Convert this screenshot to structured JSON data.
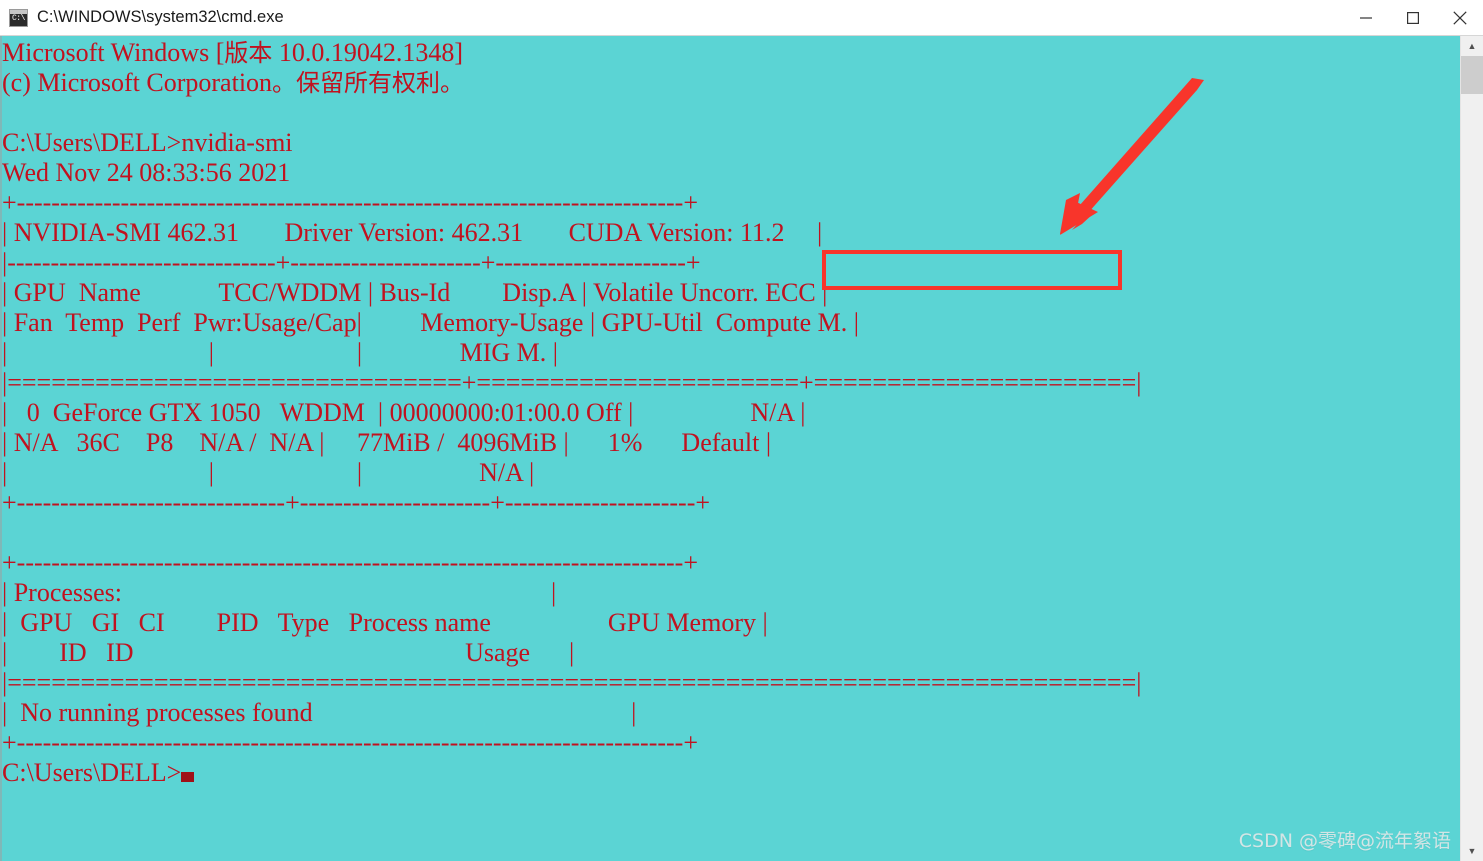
{
  "window": {
    "title": "C:\\WINDOWS\\system32\\cmd.exe",
    "icon": "cmd-icon",
    "icon_glyph": "C:\\",
    "background_color": "#5bd4d4",
    "text_color": "#c1121f",
    "controls": {
      "minimize_label": "Minimize",
      "maximize_label": "Maximize",
      "close_label": "Close"
    }
  },
  "scrollbar": {
    "up_arrow": "▲",
    "down_arrow": "▼",
    "thumb_position": "top"
  },
  "annotations": {
    "highlight_box": {
      "target_text": "CUDA Version: 11.2",
      "color": "#f8352b"
    },
    "arrow": {
      "color": "#f8352b",
      "points_to": "CUDA Version: 11.2"
    }
  },
  "watermark": {
    "text": "CSDN @零碑@流年絮语"
  },
  "terminal": {
    "banner_line_1_prefix": "Microsoft Windows [",
    "banner_line_1_cjk": "版本",
    "banner_line_1_suffix": " 10.0.19042.1348]",
    "banner_line_2_prefix": "(c) Microsoft Corporation",
    "banner_line_2_cjk": "。保留所有权利。",
    "prompt": "C:\\Users\\DELL>",
    "command": "nvidia-smi",
    "final_prompt": "C:\\Users\\DELL>",
    "timestamp": "Wed Nov 24 08:33:56 2021",
    "smi_output": [
      "+-----------------------------------------------------------------------------+",
      "| NVIDIA-SMI 462.31       Driver Version: 462.31       CUDA Version: 11.2     |",
      "|-------------------------------+----------------------+----------------------+",
      "| GPU  Name            TCC/WDDM | Bus-Id        Disp.A | Volatile Uncorr. ECC |",
      "| Fan  Temp  Perf  Pwr:Usage/Cap|         Memory-Usage | GPU-Util  Compute M. |",
      "|                               |                      |               MIG M. |",
      "|===============================+======================+======================|",
      "|   0  GeForce GTX 1050   WDDM  | 00000000:01:00.0 Off |                  N/A |",
      "| N/A   36C    P8    N/A /  N/A |     77MiB /  4096MiB |      1%      Default |",
      "|                               |                      |                  N/A |",
      "+-------------------------------+----------------------+----------------------+",
      "                                                                               ",
      "+-----------------------------------------------------------------------------+",
      "| Processes:                                                                  |",
      "|  GPU   GI   CI        PID   Type   Process name                  GPU Memory |",
      "|        ID   ID                                                   Usage      |",
      "|=============================================================================|",
      "|  No running processes found                                                 |",
      "+-----------------------------------------------------------------------------+"
    ],
    "smi_data": {
      "driver_version": "462.31",
      "nvidia_smi_version": "462.31",
      "cuda_version": "11.2",
      "gpus": [
        {
          "index": "0",
          "name": "GeForce GTX 1050",
          "driver_model": "WDDM",
          "bus_id": "00000000:01:00.0",
          "disp_a": "Off",
          "uncorr_ecc": "N/A",
          "fan": "N/A",
          "temp": "36C",
          "perf": "P8",
          "pwr_usage_cap": "N/A /  N/A",
          "memory_used": "77MiB",
          "memory_total": "4096MiB",
          "gpu_util": "1%",
          "compute_mode": "Default",
          "mig_mode": "N/A"
        }
      ],
      "processes_table": {
        "headers": [
          "GPU",
          "GI ID",
          "CI ID",
          "PID",
          "Type",
          "Process name",
          "GPU Memory Usage"
        ],
        "rows": [],
        "empty_message": "No running processes found"
      }
    }
  }
}
